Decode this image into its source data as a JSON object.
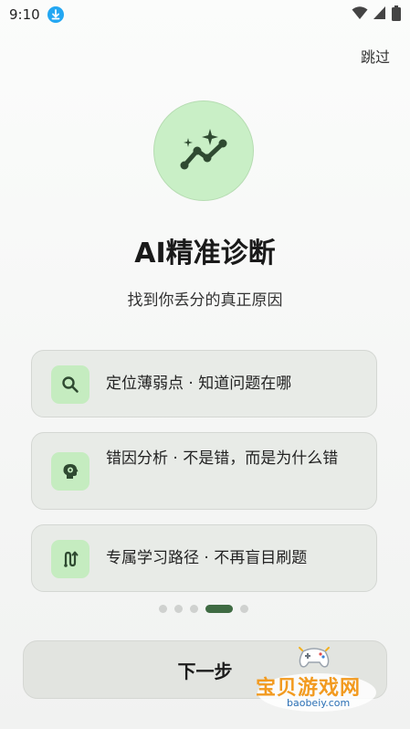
{
  "status_bar": {
    "time": "9:10"
  },
  "header": {
    "skip_label": "跳过"
  },
  "hero": {
    "icon": "sparkle-trend-icon"
  },
  "title": "AI精准诊断",
  "subtitle": "找到你丢分的真正原因",
  "features": [
    {
      "icon": "search-icon",
      "text": "定位薄弱点 · 知道问题在哪"
    },
    {
      "icon": "head-gear-icon",
      "text": "错因分析 · 不是错，而是为什么错"
    },
    {
      "icon": "route-icon",
      "text": "专属学习路径 · 不再盲目刷题"
    }
  ],
  "pager": {
    "total": 5,
    "active_index": 3
  },
  "next_button": {
    "label": "下一步"
  },
  "watermark": {
    "text": "宝贝游戏网",
    "url": "baobeiy.com"
  },
  "colors": {
    "accent": "#3f6b43",
    "icon_bg": "#c5ecc0",
    "card_bg": "#e8ebe7"
  }
}
